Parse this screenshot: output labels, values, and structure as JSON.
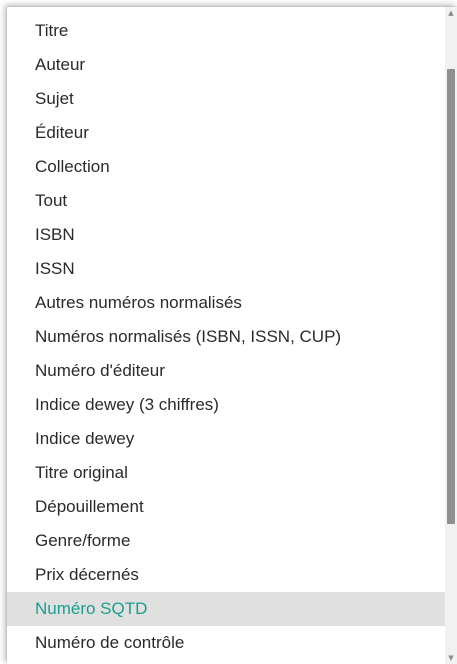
{
  "dropdown": {
    "options": [
      "Titre",
      "Auteur",
      "Sujet",
      "Éditeur",
      "Collection",
      "Tout",
      "ISBN",
      "ISSN",
      "Autres numéros normalisés",
      "Numéros normalisés (ISBN, ISSN, CUP)",
      "Numéro d'éditeur",
      "Indice dewey (3 chiffres)",
      "Indice dewey",
      "Titre original",
      "Dépouillement",
      "Genre/forme",
      "Prix décernés",
      "Numéro SQTD",
      "Numéro de contrôle"
    ],
    "highlighted_index": 17
  },
  "scrollbar": {
    "up_icon": "arrow-up-icon",
    "down_icon": "arrow-down-icon",
    "scroll_position": 0.28,
    "visible_fraction": 0.72
  },
  "colors": {
    "highlight_background": "#e0e0e0",
    "highlight_text": "#1b9e8f",
    "text": "#2a2a2a",
    "scroll_thumb": "#8f8f8f"
  }
}
